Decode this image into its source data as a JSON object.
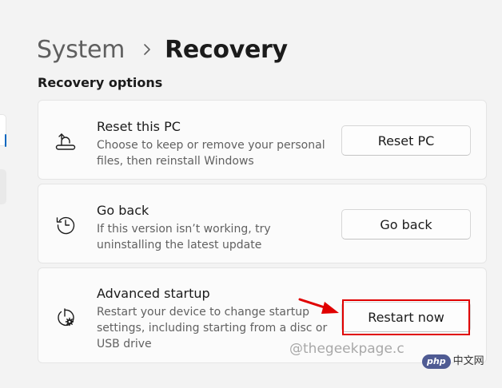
{
  "breadcrumb": {
    "parent": "System",
    "current": "Recovery"
  },
  "section": {
    "title": "Recovery options"
  },
  "options": [
    {
      "title": "Reset this PC",
      "description": "Choose to keep or remove your personal files, then reinstall Windows",
      "button_label": "Reset PC",
      "icon": "reset-pc-icon"
    },
    {
      "title": "Go back",
      "description": "If this version isn’t working, try uninstalling the latest update",
      "button_label": "Go back",
      "icon": "history-icon"
    },
    {
      "title": "Advanced startup",
      "description": "Restart your device to change startup settings, including starting from a disc or USB drive",
      "button_label": "Restart now",
      "icon": "advanced-startup-icon"
    }
  ],
  "annotation": {
    "watermark": "@thegeekpage.c",
    "logo_badge": "php",
    "logo_text": "中文网",
    "highlight_color": "#e00000"
  },
  "colors": {
    "background": "#f3f3f3",
    "card": "#fbfbfb",
    "accent": "#0067c0"
  }
}
